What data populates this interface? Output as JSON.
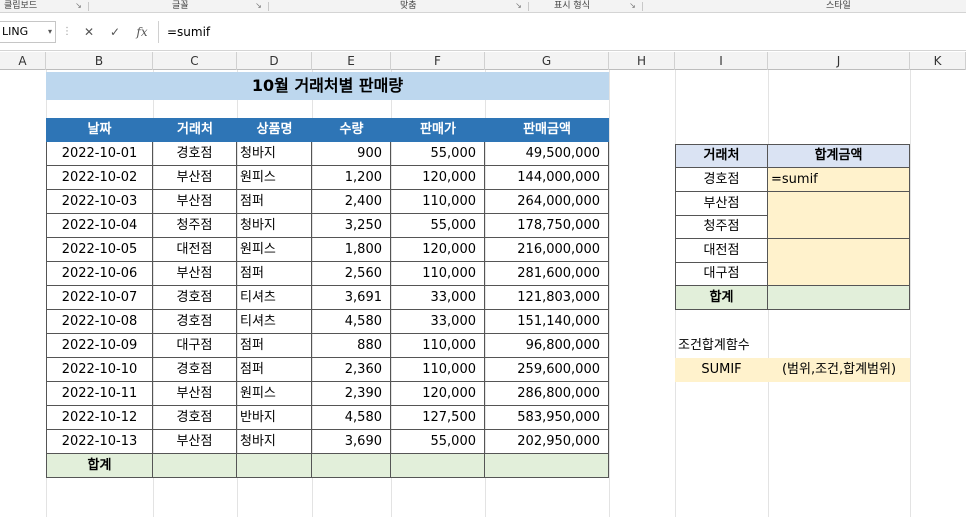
{
  "ribbon": {
    "groups": [
      "클립보드",
      "글꼴",
      "맞춤",
      "표시 형식",
      "스타일"
    ]
  },
  "formula_bar": {
    "name_box": "LING",
    "cancel": "✕",
    "enter": "✓",
    "fx": "fx",
    "formula": "=sumif"
  },
  "columns": [
    "A",
    "B",
    "C",
    "D",
    "E",
    "F",
    "G",
    "H",
    "I",
    "J",
    "K"
  ],
  "sheet": {
    "title": "10월 거래처별 판매량",
    "headers": [
      "날짜",
      "거래처",
      "상품명",
      "수량",
      "판매가",
      "판매금액"
    ],
    "rows": [
      [
        "2022-10-01",
        "경호점",
        "청바지",
        "900",
        "55,000",
        "49,500,000"
      ],
      [
        "2022-10-02",
        "부산점",
        "원피스",
        "1,200",
        "120,000",
        "144,000,000"
      ],
      [
        "2022-10-03",
        "부산점",
        "점퍼",
        "2,400",
        "110,000",
        "264,000,000"
      ],
      [
        "2022-10-04",
        "청주점",
        "청바지",
        "3,250",
        "55,000",
        "178,750,000"
      ],
      [
        "2022-10-05",
        "대전점",
        "원피스",
        "1,800",
        "120,000",
        "216,000,000"
      ],
      [
        "2022-10-06",
        "부산점",
        "점퍼",
        "2,560",
        "110,000",
        "281,600,000"
      ],
      [
        "2022-10-07",
        "경호점",
        "티셔츠",
        "3,691",
        "33,000",
        "121,803,000"
      ],
      [
        "2022-10-08",
        "경호점",
        "티셔츠",
        "4,580",
        "33,000",
        "151,140,000"
      ],
      [
        "2022-10-09",
        "대구점",
        "점퍼",
        "880",
        "110,000",
        "96,800,000"
      ],
      [
        "2022-10-10",
        "경호점",
        "점퍼",
        "2,360",
        "110,000",
        "259,600,000"
      ],
      [
        "2022-10-11",
        "부산점",
        "원피스",
        "2,390",
        "120,000",
        "286,800,000"
      ],
      [
        "2022-10-12",
        "경호점",
        "반바지",
        "4,580",
        "127,500",
        "583,950,000"
      ],
      [
        "2022-10-13",
        "부산점",
        "청바지",
        "3,690",
        "55,000",
        "202,950,000"
      ]
    ],
    "total_label": "합계"
  },
  "summary": {
    "headers": [
      "거래처",
      "합계금액"
    ],
    "rows": [
      [
        "경호점",
        "=sumif"
      ],
      [
        "부산점",
        ""
      ],
      [
        "청주점",
        ""
      ],
      [
        "대전점",
        ""
      ],
      [
        "대구점",
        ""
      ]
    ],
    "total_label": "합계"
  },
  "note": {
    "label": "조건합계함수",
    "function": "SUMIF",
    "syntax": "(범위,조건,합계범위)"
  }
}
